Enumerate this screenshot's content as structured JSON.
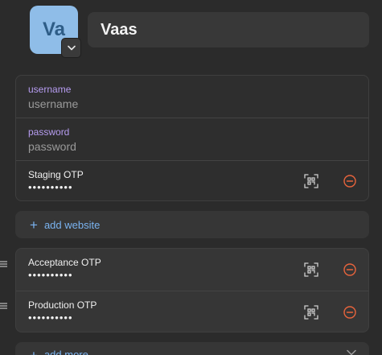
{
  "header": {
    "avatar_initials": "Va",
    "title": "Vaas"
  },
  "login": {
    "username_label": "username",
    "username_placeholder": "username",
    "password_label": "password",
    "password_placeholder": "password",
    "otp_label": "Staging OTP",
    "otp_value": "••••••••••"
  },
  "add_website": {
    "label": "add website",
    "icon": "plus-icon"
  },
  "extra_fields": [
    {
      "label": "Acceptance OTP",
      "value": "••••••••••"
    },
    {
      "label": "Production OTP",
      "value": "••••••••••"
    }
  ],
  "add_more": {
    "label": "add more",
    "icon": "plus-icon"
  },
  "colors": {
    "background": "#2b2b2b",
    "avatar_bg": "#8fbde8",
    "accent_blue": "#7ab3f0",
    "label_purple": "#b69cf0",
    "remove_red": "#e8643c"
  }
}
